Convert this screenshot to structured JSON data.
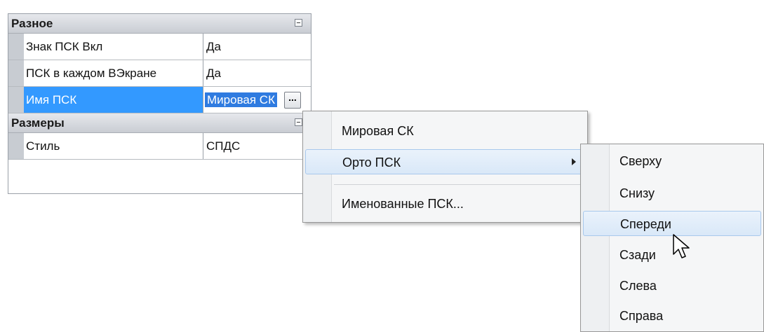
{
  "grid": {
    "categories": [
      {
        "label": "Разное",
        "rows": [
          {
            "name": "Знак ПСК Вкл",
            "value": "Да"
          },
          {
            "name": "ПСК в каждом ВЭкране",
            "value": "Да"
          },
          {
            "name": "Имя ПСК",
            "value": "Мировая СК",
            "ellipsis": "..."
          }
        ]
      },
      {
        "label": "Размеры",
        "rows": [
          {
            "name": "Стиль",
            "value": "СПДС"
          }
        ]
      }
    ]
  },
  "menu": {
    "items": [
      "Мировая СК",
      "Орто ПСК",
      "Именованные ПСК..."
    ]
  },
  "submenu": {
    "items": [
      "Сверху",
      "Снизу",
      "Спереди",
      "Сзади",
      "Слева",
      "Справа"
    ]
  },
  "colors": {
    "selection": "#3399ff",
    "category_header": "#d3d6db",
    "menu_highlight": "#d9e8f8"
  },
  "icons": {
    "collapse": "minus-box-icon",
    "submenu_arrow": "triangle-right-icon",
    "cursor": "arrow-pointer-icon"
  }
}
